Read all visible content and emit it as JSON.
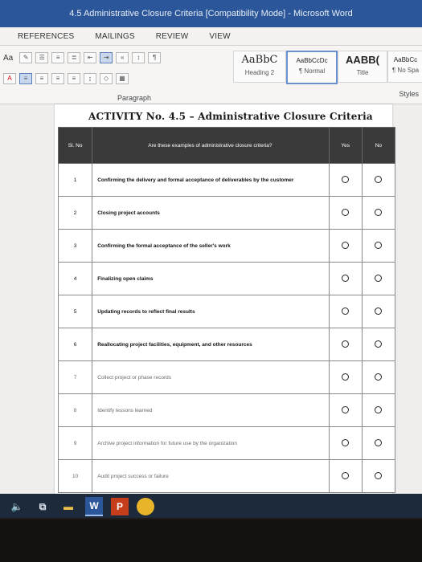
{
  "window": {
    "title": "4.5 Administrative Closure Criteria [Compatibility Mode] - Microsoft Word"
  },
  "ribbon": {
    "tabs": [
      "REFERENCES",
      "MAILINGS",
      "REVIEW",
      "VIEW"
    ],
    "font_size_label": "Aa",
    "paragraph_group_label": "Paragraph",
    "styles_group_label": "Styles",
    "styles": [
      {
        "sample": "AaBbC",
        "name": "Heading 2"
      },
      {
        "sample": "AaBbCcDc",
        "name": "¶ Normal"
      },
      {
        "sample": "AABB(",
        "name": "Title"
      },
      {
        "sample": "AaBbCc",
        "name": "¶ No Spa"
      }
    ]
  },
  "document": {
    "title": "ACTIVITY No. 4.5 – Administrative Closure Criteria",
    "table": {
      "headers": {
        "no": "Sl. No",
        "question": "Are these examples of administrative closure criteria?",
        "yes": "Yes",
        "no_answer": "No"
      },
      "rows": [
        {
          "num": "1",
          "text": "Confirming the delivery and formal acceptance of deliverables by the customer"
        },
        {
          "num": "2",
          "text": "Closing project accounts"
        },
        {
          "num": "3",
          "text": "Confirming the formal acceptance of the seller's work"
        },
        {
          "num": "4",
          "text": "Finalizing open claims"
        },
        {
          "num": "5",
          "text": "Updating records to reflect final results"
        },
        {
          "num": "6",
          "text": "Reallocating project facilities, equipment, and other resources"
        },
        {
          "num": "7",
          "text": "Collect project or phase records"
        },
        {
          "num": "8",
          "text": "Identify lessons learned"
        },
        {
          "num": "9",
          "text": "Archive project information for future use by the organization"
        },
        {
          "num": "10",
          "text": "Audit project success or failure"
        }
      ]
    }
  },
  "taskbar": {
    "items": [
      "speaker-icon",
      "task-view-icon",
      "file-explorer-icon",
      "word-icon",
      "powerpoint-icon",
      "chrome-icon"
    ],
    "word_label": "W",
    "ppt_label": "P"
  },
  "colors": {
    "title_bar": "#2b579a",
    "table_header": "#3a3a3a",
    "taskbar": "#1d2a3c"
  }
}
